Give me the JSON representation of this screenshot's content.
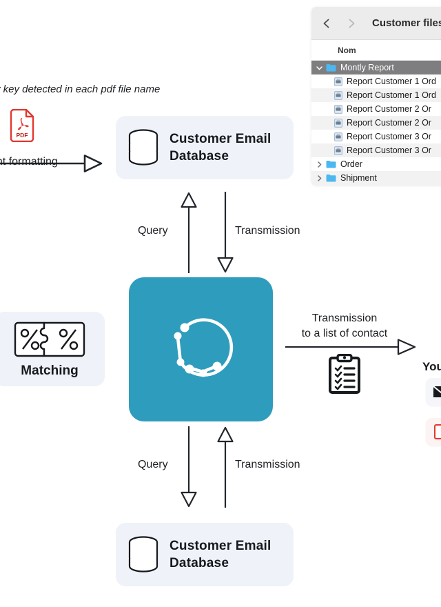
{
  "diagram": {
    "top_caption_italic": "ry key detected in each pdf file name",
    "top_caption_plain": "ent formatting",
    "pdf_icon": "pdf-file-icon",
    "pdf_label": "PDF",
    "database_top": {
      "icon": "database-cylinder-icon",
      "label": "Customer  Email\nDatabase"
    },
    "database_bottom": {
      "icon": "database-cylinder-icon",
      "label": "Customer  Email\nDatabase"
    },
    "matching": {
      "icon": "puzzle-percent-icon",
      "label": "Matching"
    },
    "hub": {
      "icon": "network-circle-nodes-icon",
      "color": "#2e9cbd"
    },
    "edges": {
      "top_query": "Query",
      "top_transmission": "Transmission",
      "bottom_query": "Query",
      "bottom_transmission": "Transmission",
      "right_transmission_line1": "Transmission",
      "right_transmission_line2": "to a list of contact"
    },
    "clipboard_icon": "clipboard-checklist-icon",
    "right_column": {
      "heading": "You",
      "cards": [
        {
          "icon": "mail-send-icon"
        },
        {
          "icon": "document-red-icon"
        }
      ]
    }
  },
  "file_browser": {
    "toolbar": {
      "back_icon": "chevron-left-icon",
      "forward_icon": "chevron-right-icon",
      "title": "Customer files"
    },
    "column_header": "Nom",
    "rows": [
      {
        "type": "folder",
        "label": "Montly Report",
        "expanded": true,
        "selected": true,
        "disclosure": "chevron-down-icon",
        "icon": "folder-icon"
      },
      {
        "type": "file",
        "label": "Report Customer 1 Ord",
        "icon": "document-icon"
      },
      {
        "type": "file",
        "label": "Report Customer 1 Ord",
        "icon": "document-icon"
      },
      {
        "type": "file",
        "label": "Report Customer 2 Or",
        "icon": "document-icon"
      },
      {
        "type": "file",
        "label": "Report Customer 2 Or",
        "icon": "document-icon"
      },
      {
        "type": "file",
        "label": "Report Customer 3 Or",
        "icon": "document-icon"
      },
      {
        "type": "file",
        "label": "Report Customer 3 Or",
        "icon": "document-icon"
      },
      {
        "type": "folder",
        "label": "Order",
        "expanded": false,
        "selected": false,
        "disclosure": "chevron-right-icon",
        "icon": "folder-icon"
      },
      {
        "type": "folder",
        "label": "Shipment",
        "expanded": false,
        "selected": false,
        "disclosure": "chevron-right-icon",
        "icon": "folder-icon"
      }
    ]
  }
}
